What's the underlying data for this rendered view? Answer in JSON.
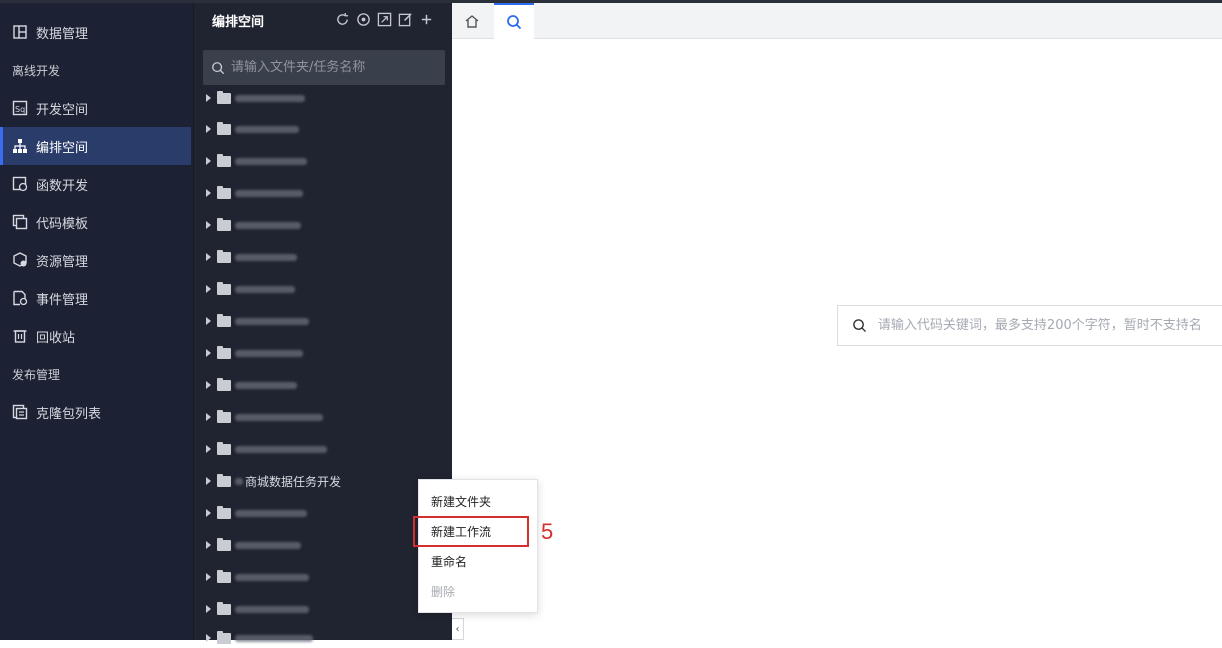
{
  "nav": {
    "items": [
      {
        "label": "数据管理",
        "icon": "data-management-icon"
      },
      {
        "label": "开发空间",
        "icon": "sql-icon"
      },
      {
        "label": "编排空间",
        "icon": "sitemap-icon",
        "active": true
      },
      {
        "label": "函数开发",
        "icon": "function-icon"
      },
      {
        "label": "代码模板",
        "icon": "template-icon"
      },
      {
        "label": "资源管理",
        "icon": "resource-icon"
      },
      {
        "label": "事件管理",
        "icon": "event-icon"
      },
      {
        "label": "回收站",
        "icon": "trash-icon"
      },
      {
        "label": "克隆包列表",
        "icon": "clone-icon"
      }
    ],
    "groups": {
      "offline": "离线开发",
      "publish": "发布管理"
    }
  },
  "tree": {
    "title": "编排空间",
    "search_placeholder": "请输入文件夹/任务名称",
    "tools": [
      "refresh-icon",
      "locate-icon",
      "collapse-all-icon",
      "edit-icon",
      "add-icon"
    ],
    "visible_folder_label": "商城数据任务开发"
  },
  "tabs": [
    {
      "icon": "home-icon"
    },
    {
      "icon": "search-icon",
      "active": true
    }
  ],
  "code_search": {
    "placeholder": "请输入代码关键词，最多支持200个字符，暂时不支持名"
  },
  "context_menu": {
    "items": [
      "新建文件夹",
      "新建工作流",
      "重命名",
      "删除"
    ],
    "disabled": [
      "删除"
    ],
    "highlighted": "新建工作流"
  },
  "annotation": {
    "step": "5"
  },
  "colors": {
    "nav_bg": "#1c2233",
    "active": "#2a3d6a",
    "accent": "#2f6bf0",
    "highlight": "#d32f2f"
  }
}
